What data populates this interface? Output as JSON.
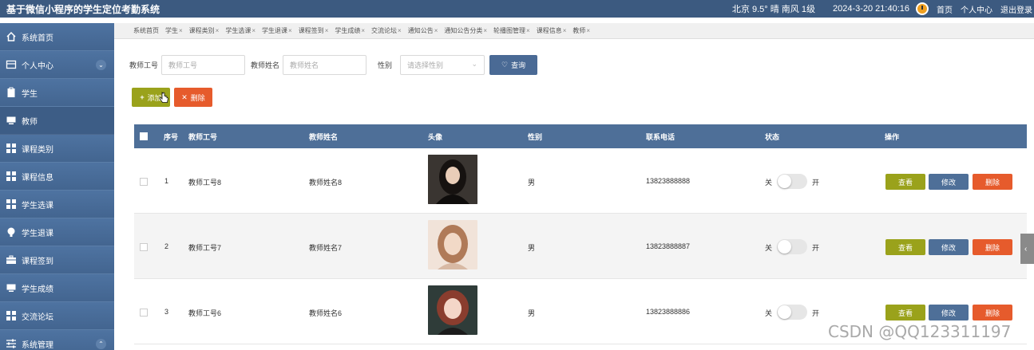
{
  "header": {
    "title": "基于微信小程序的学生定位考勤系统",
    "weather": "北京 9.5° 晴 南风 1级",
    "datetime": "2024-3-20 21:40:16",
    "links": [
      "首页",
      "个人中心",
      "退出登录"
    ]
  },
  "sidebar": {
    "items": [
      {
        "label": "系统首页",
        "icon": "home-icon"
      },
      {
        "label": "个人中心",
        "icon": "profile-icon"
      },
      {
        "label": "学生",
        "icon": "clipboard-icon"
      },
      {
        "label": "教师",
        "icon": "monitor-icon"
      },
      {
        "label": "课程类别",
        "icon": "grid-icon"
      },
      {
        "label": "课程信息",
        "icon": "grid-icon"
      },
      {
        "label": "学生选课",
        "icon": "grid-icon"
      },
      {
        "label": "学生退课",
        "icon": "bulb-icon"
      },
      {
        "label": "课程签到",
        "icon": "briefcase-icon"
      },
      {
        "label": "学生成绩",
        "icon": "monitor-icon"
      },
      {
        "label": "交流论坛",
        "icon": "grid-icon"
      },
      {
        "label": "系统管理",
        "icon": "sliders-icon"
      }
    ]
  },
  "tabs": [
    {
      "label": "系统首页",
      "closable": false
    },
    {
      "label": "学生",
      "closable": true
    },
    {
      "label": "课程类别",
      "closable": true
    },
    {
      "label": "学生选课",
      "closable": true
    },
    {
      "label": "学生退课",
      "closable": true
    },
    {
      "label": "课程签到",
      "closable": true
    },
    {
      "label": "学生成绩",
      "closable": true
    },
    {
      "label": "交流论坛",
      "closable": true
    },
    {
      "label": "通知公告",
      "closable": true
    },
    {
      "label": "通知公告分类",
      "closable": true
    },
    {
      "label": "轮播图管理",
      "closable": true
    },
    {
      "label": "课程信息",
      "closable": true
    },
    {
      "label": "教师",
      "closable": true
    }
  ],
  "tab_close": "×",
  "search": {
    "teacher_no_label": "教师工号",
    "teacher_no_placeholder": "教师工号",
    "teacher_name_label": "教师姓名",
    "teacher_name_placeholder": "教师姓名",
    "gender_label": "性别",
    "gender_placeholder": "请选择性别",
    "query_label": "查询"
  },
  "actions": {
    "add_label": "添加",
    "delete_label": "删除"
  },
  "table": {
    "headers": [
      "序号",
      "教师工号",
      "教师姓名",
      "头像",
      "性别",
      "联系电话",
      "状态",
      "操作"
    ],
    "rows": [
      {
        "index": "1",
        "teacher_no": "教师工号8",
        "teacher_name": "教师姓名8",
        "gender": "男",
        "phone": "13823888888"
      },
      {
        "index": "2",
        "teacher_no": "教师工号7",
        "teacher_name": "教师姓名7",
        "gender": "男",
        "phone": "13823888887"
      },
      {
        "index": "3",
        "teacher_no": "教师工号6",
        "teacher_name": "教师姓名6",
        "gender": "男",
        "phone": "13823888886"
      }
    ],
    "switch_off": "关",
    "switch_on": "开",
    "view_label": "查看",
    "edit_label": "修改",
    "delete_label": "删除"
  },
  "watermark": "CSDN @QQ123311197",
  "colors": {
    "topbar": "#3c5a80",
    "sidebar": "#476a96",
    "olive": "#9aa21b",
    "orange": "#e65b2c",
    "steel": "#4e6f98"
  }
}
